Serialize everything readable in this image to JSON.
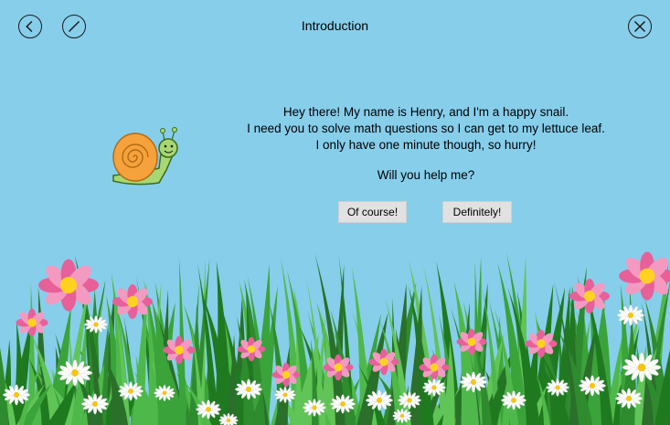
{
  "window": {
    "title": "Introduction"
  },
  "toolbar": {
    "back_icon": "back-arrow-icon",
    "edit_icon": "pencil-slash-icon",
    "close_icon": "close-icon"
  },
  "dialog": {
    "lines": [
      "Hey there! My name is Henry, and I'm a happy snail.",
      "I need you to solve math questions so I can get to my lettuce leaf.",
      "I only have one minute though, so hurry!"
    ],
    "question": "Will you help me?"
  },
  "buttons": {
    "of_course": "Of course!",
    "definitely": "Definitely!"
  },
  "colors": {
    "sky": "#87ceeb",
    "button": "#e1e1e1",
    "snail_shell": "#f5a23c",
    "snail_body": "#a8d672"
  }
}
